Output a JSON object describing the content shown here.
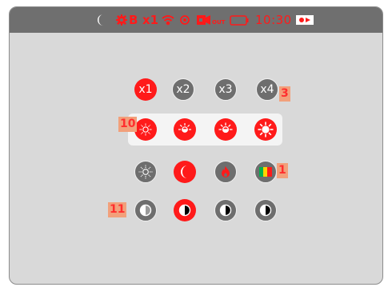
{
  "status_bar": {
    "icons": [
      "moon-icon",
      "gear-icon",
      "wifi-icon",
      "eye-icon",
      "video-out-icon",
      "battery-icon",
      "record-icon"
    ],
    "mode_label": "B",
    "zoom_label": "x1",
    "video_out_label": "OUT",
    "clock": "10:30"
  },
  "zoom_row": {
    "buttons": [
      {
        "label": "x1",
        "active": true
      },
      {
        "label": "x2",
        "active": false
      },
      {
        "label": "x3",
        "active": false
      },
      {
        "label": "x4",
        "active": false
      }
    ]
  },
  "brightness_row": {
    "icons": [
      "brightness-1-icon",
      "brightness-2-icon",
      "brightness-3-icon",
      "brightness-4-icon"
    ]
  },
  "mode_row": {
    "icons": [
      "sun-icon",
      "moon-icon",
      "flame-icon",
      "color-palette-icon"
    ],
    "active": "moon-icon"
  },
  "contrast_row": {
    "icons": [
      "contrast-1-icon",
      "contrast-2-icon",
      "contrast-3-icon",
      "contrast-4-icon"
    ],
    "active": "contrast-2-icon"
  },
  "callouts": {
    "zoom": "3",
    "brightness": "10",
    "palette": "1",
    "contrast": "11"
  },
  "colors": {
    "accent": "#ff1a1a",
    "button_off": "#6e6e6e",
    "background": "#d9d9d9",
    "status_bar": "#6f6f6f",
    "callout_bg": "#f2a07b"
  }
}
